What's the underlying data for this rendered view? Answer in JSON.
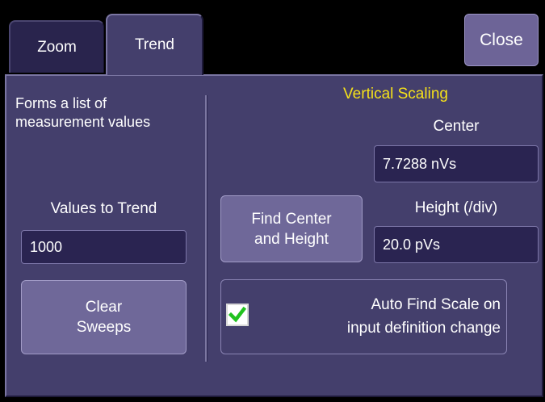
{
  "tabs": [
    {
      "label": "Zoom",
      "active": false
    },
    {
      "label": "Trend",
      "active": true
    }
  ],
  "close_label": "Close",
  "description": [
    "Forms a list of",
    "measurement values"
  ],
  "values_to_trend": {
    "label": "Values to Trend",
    "value": "1000"
  },
  "clear_sweeps": [
    "Clear",
    "Sweeps"
  ],
  "vertical_scaling": {
    "title": "Vertical Scaling",
    "center_label": "Center",
    "center_value": "7.7288 nVs",
    "height_label": "Height (/div)",
    "height_value": "20.0 pVs",
    "find_button": [
      "Find Center",
      "and Height"
    ]
  },
  "auto_find": {
    "checked": true,
    "lines": [
      "Auto Find Scale on",
      "input definition change"
    ]
  },
  "colors": {
    "background": "#443f6c",
    "heading": "#f5e11a",
    "button": "#6f6899",
    "field": "#2a2451",
    "check": "#21c21f"
  },
  "icons": {
    "checkbox": "check-icon"
  }
}
